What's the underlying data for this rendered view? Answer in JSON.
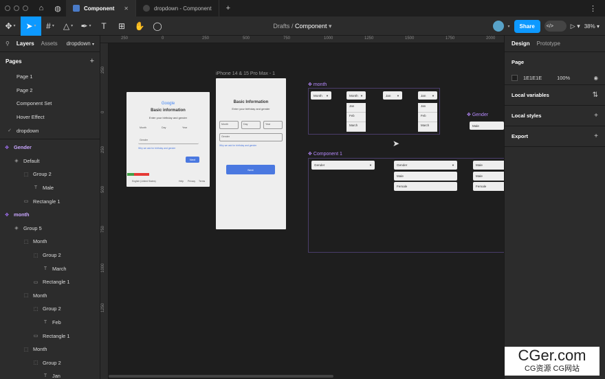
{
  "tabs": [
    {
      "label": "Component",
      "active": true
    },
    {
      "label": "dropdown - Component",
      "active": false
    }
  ],
  "breadcrumb": {
    "root": "Drafts",
    "sep": "/",
    "current": "Component"
  },
  "toolbar": {
    "share": "Share",
    "zoom": "38%"
  },
  "left_panel": {
    "tab_layers": "Layers",
    "tab_assets": "Assets",
    "page_selector": "dropdown",
    "pages_title": "Pages",
    "pages": [
      "Page 1",
      "Page 2",
      "Component Set",
      "Hover Effect",
      "dropdown"
    ],
    "layers": [
      {
        "label": "Gender",
        "indent": 0,
        "comp": true,
        "icon": "✥"
      },
      {
        "label": "Default",
        "indent": 1,
        "comp": false,
        "icon": "◈"
      },
      {
        "label": "Group 2",
        "indent": 2,
        "comp": false,
        "icon": "⬚"
      },
      {
        "label": "Male",
        "indent": 3,
        "comp": false,
        "icon": "T"
      },
      {
        "label": "Rectangle 1",
        "indent": 2,
        "comp": false,
        "icon": "▭"
      },
      {
        "label": "month",
        "indent": 0,
        "comp": true,
        "icon": "✥"
      },
      {
        "label": "Group 5",
        "indent": 1,
        "comp": false,
        "icon": "◈"
      },
      {
        "label": "Month",
        "indent": 2,
        "comp": false,
        "icon": "⬚"
      },
      {
        "label": "Group 2",
        "indent": 3,
        "comp": false,
        "icon": "⬚"
      },
      {
        "label": "March",
        "indent": 4,
        "comp": false,
        "icon": "T"
      },
      {
        "label": "Rectangle 1",
        "indent": 3,
        "comp": false,
        "icon": "▭"
      },
      {
        "label": "Month",
        "indent": 2,
        "comp": false,
        "icon": "⬚"
      },
      {
        "label": "Group 2",
        "indent": 3,
        "comp": false,
        "icon": "⬚"
      },
      {
        "label": "Feb",
        "indent": 4,
        "comp": false,
        "icon": "T"
      },
      {
        "label": "Rectangle 1",
        "indent": 3,
        "comp": false,
        "icon": "▭"
      },
      {
        "label": "Month",
        "indent": 2,
        "comp": false,
        "icon": "⬚"
      },
      {
        "label": "Group 2",
        "indent": 3,
        "comp": false,
        "icon": "⬚"
      },
      {
        "label": "Jan",
        "indent": 4,
        "comp": false,
        "icon": "T"
      }
    ]
  },
  "rulers": {
    "top": [
      "250",
      "0",
      "250",
      "500",
      "750",
      "1000",
      "1250",
      "1500",
      "1750",
      "2000"
    ],
    "left": [
      "250",
      "0",
      "250",
      "500",
      "750",
      "1000",
      "1250"
    ]
  },
  "canvas": {
    "frame1": {
      "logo": "Google",
      "title": "Basic information",
      "subtitle": "Enter your birthday and gender",
      "month": "Month",
      "day": "Day",
      "year": "Year",
      "gender": "Gender",
      "why": "Why we ask for birthday and gender",
      "next": "Next",
      "footer_lang": "English (United States)",
      "help": "Help",
      "privacy": "Privacy",
      "terms": "Terms"
    },
    "frame2": {
      "label": "iPhone 14 & 15 Pro Max - 1",
      "title": "Basic Information",
      "subtitle": "Enter your birthday and gender",
      "month": "Month",
      "day": "Day",
      "year": "Year",
      "gender": "Gender",
      "why": "Why we ask for birthday and gender",
      "next": "Next"
    },
    "month_set": {
      "label": "month",
      "dd1": "Month",
      "dd2": "Month",
      "dd3": "Jan",
      "dd4": "Jan",
      "opts": [
        "Jan",
        "Feb",
        "March"
      ]
    },
    "gender_comp": {
      "label": "Gender",
      "value": "Male"
    },
    "component1": {
      "label": "Component 1",
      "dd1": "Gender",
      "dd2": "Gender",
      "dd3": "Male",
      "opts_a": [
        "Male",
        "Female"
      ],
      "opts_b": [
        "Male",
        "Female"
      ]
    }
  },
  "right_panel": {
    "tab_design": "Design",
    "tab_prototype": "Prototype",
    "page_title": "Page",
    "bg_hex": "1E1E1E",
    "bg_opacity": "100%",
    "local_variables": "Local variables",
    "local_styles": "Local styles",
    "export": "Export"
  },
  "watermark": {
    "big": "CGer.com",
    "small": "CG资源 CG网站"
  }
}
